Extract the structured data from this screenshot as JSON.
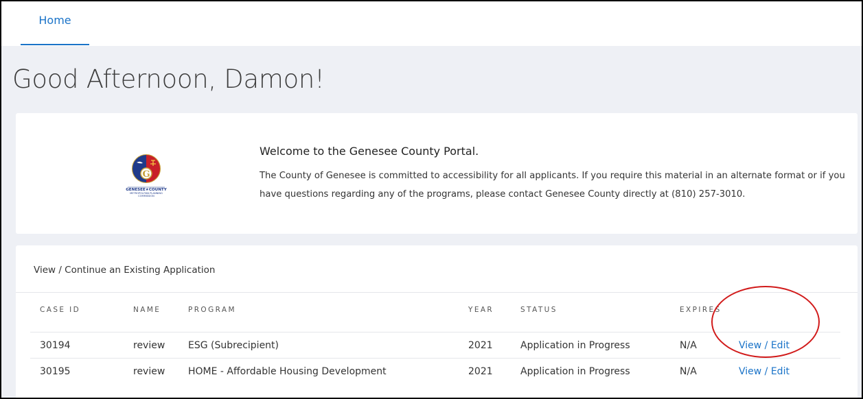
{
  "nav": {
    "home_label": "Home"
  },
  "greeting": "Good Afternoon, Damon!",
  "welcome": {
    "title": "Welcome to the Genesee County Portal.",
    "body": "The County of Genesee is committed to accessibility for all applicants. If you require this material in an alternate format or if you have questions regarding any of the programs, please contact Genesee County directly at (810) 257-3010.",
    "logo": {
      "line1": "GENESEE★COUNTY",
      "line2": "METROPOLITAN PLANNING",
      "line3": "COMMISSION",
      "letter": "G"
    }
  },
  "applications": {
    "title": "View / Continue an Existing Application",
    "columns": {
      "case_id": "CASE ID",
      "name": "NAME",
      "program": "PROGRAM",
      "year": "YEAR",
      "status": "STATUS",
      "expires": "EXPIRES"
    },
    "rows": [
      {
        "case_id": "30194",
        "name": "review",
        "program": "ESG (Subrecipient)",
        "year": "2021",
        "status": "Application in Progress",
        "expires": "N/A",
        "action": "View / Edit"
      },
      {
        "case_id": "30195",
        "name": "review",
        "program": "HOME - Affordable Housing Development",
        "year": "2021",
        "status": "Application in Progress",
        "expires": "N/A",
        "action": "View / Edit"
      }
    ]
  },
  "colors": {
    "accent": "#1a73c8",
    "annotation": "#d11a1a",
    "page_bg": "#eef0f5"
  }
}
